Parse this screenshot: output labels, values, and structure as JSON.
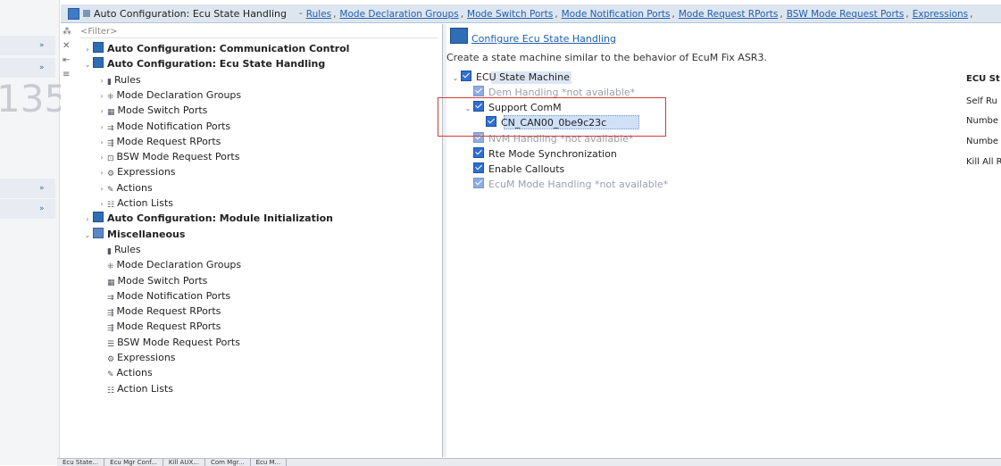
{
  "left_strip": {
    "number": "135"
  },
  "header": {
    "title": "Auto Configuration: Ecu State Handling",
    "links": [
      "Rules",
      "Mode Declaration Groups",
      "Mode Switch Ports",
      "Mode Notification Ports",
      "Mode Request RPorts",
      "BSW Mode Request Ports",
      "Expressions"
    ]
  },
  "filter": {
    "placeholder": "<Filter>"
  },
  "tree": [
    {
      "label": "Auto Configuration: Communication Control",
      "indent": 0,
      "twisty": ">",
      "icon": "cfg",
      "bold": true
    },
    {
      "label": "Auto Configuration: Ecu State Handling",
      "indent": 0,
      "twisty": "v",
      "icon": "cfg",
      "bold": true
    },
    {
      "label": "Rules",
      "indent": 1,
      "twisty": ">",
      "icon": "rules-icon",
      "glyph": "▮",
      "bold": false
    },
    {
      "label": "Mode Declaration Groups",
      "indent": 1,
      "twisty": ">",
      "icon": "mode-declaration-icon",
      "glyph": "⁜",
      "bold": false
    },
    {
      "label": "Mode Switch Ports",
      "indent": 1,
      "twisty": ">",
      "icon": "mode-switch-icon",
      "glyph": "▦",
      "bold": false
    },
    {
      "label": "Mode Notification Ports",
      "indent": 1,
      "twisty": ">",
      "icon": "mode-notification-icon",
      "glyph": "⇉",
      "bold": false
    },
    {
      "label": "Mode Request RPorts",
      "indent": 1,
      "twisty": ">",
      "icon": "mode-request-icon",
      "glyph": "⇶",
      "bold": false
    },
    {
      "label": "BSW Mode Request Ports",
      "indent": 1,
      "twisty": ">",
      "icon": "bsw-mode-icon",
      "glyph": "⊡",
      "bold": false
    },
    {
      "label": "Expressions",
      "indent": 1,
      "twisty": ">",
      "icon": "expressions-icon",
      "glyph": "⚙",
      "bold": false
    },
    {
      "label": "Actions",
      "indent": 1,
      "twisty": ">",
      "icon": "actions-icon",
      "glyph": "✎",
      "bold": false
    },
    {
      "label": "Action Lists",
      "indent": 1,
      "twisty": ">",
      "icon": "action-lists-icon",
      "glyph": "☷",
      "bold": false
    },
    {
      "label": "Auto Configuration: Module Initialization",
      "indent": 0,
      "twisty": ">",
      "icon": "cfg",
      "bold": true
    },
    {
      "label": "Miscellaneous",
      "indent": 0,
      "twisty": "v",
      "icon": "misc",
      "bold": true
    },
    {
      "label": "Rules",
      "indent": 1,
      "twisty": "",
      "icon": "rules-icon",
      "glyph": "▮",
      "bold": false
    },
    {
      "label": "Mode Declaration Groups",
      "indent": 1,
      "twisty": "",
      "icon": "mode-declaration-icon",
      "glyph": "⁜",
      "bold": false
    },
    {
      "label": "Mode Switch Ports",
      "indent": 1,
      "twisty": "",
      "icon": "mode-switch-icon",
      "glyph": "▦",
      "bold": false
    },
    {
      "label": "Mode Notification Ports",
      "indent": 1,
      "twisty": "",
      "icon": "mode-notification-icon",
      "glyph": "⇉",
      "bold": false
    },
    {
      "label": "Mode Request RPorts",
      "indent": 1,
      "twisty": "",
      "icon": "mode-request-icon",
      "glyph": "⇶",
      "bold": false
    },
    {
      "label": "Mode Request RPorts",
      "indent": 1,
      "twisty": "",
      "icon": "mode-request-icon",
      "glyph": "⇶",
      "bold": false
    },
    {
      "label": "BSW Mode Request Ports",
      "indent": 1,
      "twisty": "",
      "icon": "bsw-mode-icon",
      "glyph": "☰",
      "bold": false
    },
    {
      "label": "Expressions",
      "indent": 1,
      "twisty": "",
      "icon": "expressions-icon",
      "glyph": "⚙",
      "bold": false
    },
    {
      "label": "Actions",
      "indent": 1,
      "twisty": "",
      "icon": "actions-icon",
      "glyph": "✎",
      "bold": false
    },
    {
      "label": "Action Lists",
      "indent": 1,
      "twisty": "",
      "icon": "action-lists-icon",
      "glyph": "☷",
      "bold": false
    }
  ],
  "details": {
    "link": "Configure Ecu State Handling",
    "description": "Create a state machine similar to the behavior of EcuM Fix ASR3.",
    "options": [
      {
        "label": "ECU State Machine",
        "level": 0,
        "twisty": "v",
        "enabled": true,
        "grey": false
      },
      {
        "label": "Dem Handling *not available*",
        "level": 1,
        "twisty": "",
        "enabled": false,
        "grey": true
      },
      {
        "label": "Support ComM",
        "level": 1,
        "twisty": "v",
        "enabled": true,
        "grey": false
      },
      {
        "label": "CN_CAN00_0be9c23c",
        "level": 2,
        "twisty": "",
        "enabled": true,
        "grey": false
      },
      {
        "label": "NvM Handling *not available*",
        "level": 1,
        "twisty": "",
        "enabled": false,
        "grey": true
      },
      {
        "label": "Rte Mode Synchronization",
        "level": 1,
        "twisty": "",
        "enabled": true,
        "grey": false
      },
      {
        "label": "Enable Callouts",
        "level": 1,
        "twisty": "",
        "enabled": true,
        "grey": false
      },
      {
        "label": "EcuM Mode Handling *not available*",
        "level": 1,
        "twisty": "",
        "enabled": false,
        "grey": true
      }
    ],
    "side_labels": [
      "ECU St",
      "Self Ru",
      "Numbe",
      "Numbe",
      "Kill All R"
    ]
  },
  "bottom_tabs": [
    "Ecu State...",
    "Ecu Mgr Conf...",
    "Kill AUX...",
    "Com Mgr...",
    "Ecu M..."
  ]
}
